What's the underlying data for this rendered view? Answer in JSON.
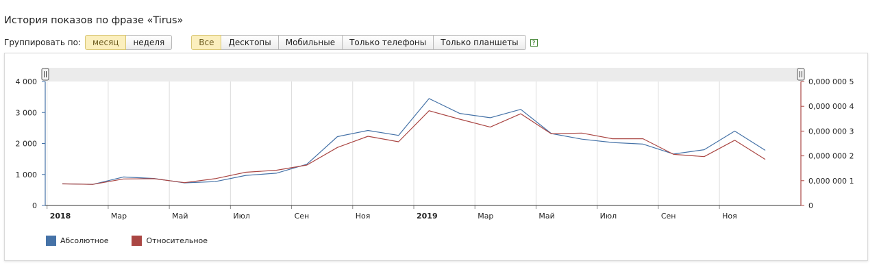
{
  "header": {
    "title": "История показов по фразе «Tirus»"
  },
  "toolbar": {
    "group_label": "Группировать по:",
    "group_buttons": [
      {
        "label": "месяц",
        "active": true
      },
      {
        "label": "неделя",
        "active": false
      }
    ],
    "device_buttons": [
      {
        "label": "Все",
        "active": true
      },
      {
        "label": "Десктопы",
        "active": false
      },
      {
        "label": "Мобильные",
        "active": false
      },
      {
        "label": "Только телефоны",
        "active": false
      },
      {
        "label": "Только планшеты",
        "active": false
      }
    ],
    "help_label": "?"
  },
  "chart_data": {
    "type": "line",
    "x_ticks": [
      "2018",
      "Мар",
      "Май",
      "Июл",
      "Сен",
      "Ноя",
      "2019",
      "Мар",
      "Май",
      "Июл",
      "Сен",
      "Ноя"
    ],
    "x_ticks_bold": [
      "2018",
      "2019"
    ],
    "x": [
      "2018-01",
      "2018-02",
      "2018-03",
      "2018-04",
      "2018-05",
      "2018-06",
      "2018-07",
      "2018-08",
      "2018-09",
      "2018-10",
      "2018-11",
      "2018-12",
      "2019-01",
      "2019-02",
      "2019-03",
      "2019-04",
      "2019-05",
      "2019-06",
      "2019-07",
      "2019-08",
      "2019-09",
      "2019-10",
      "2019-11",
      "2019-12"
    ],
    "y_left": {
      "ticks": [
        "0",
        "1 000",
        "2 000",
        "3 000",
        "4 000"
      ],
      "ylim": [
        0,
        4000
      ]
    },
    "y_right": {
      "ticks": [
        "0",
        "0,000 000 1",
        "0,000 000 2",
        "0,000 000 3",
        "0,000 000 4",
        "0,000 000 5"
      ],
      "ylim": [
        0,
        5e-07
      ]
    },
    "series": [
      {
        "name": "Абсолютное",
        "color": "#4572a7",
        "axis": "left",
        "values": [
          700,
          680,
          920,
          870,
          730,
          770,
          970,
          1040,
          1330,
          2220,
          2420,
          2260,
          3450,
          2970,
          2830,
          3100,
          2320,
          2140,
          2030,
          1980,
          1660,
          1800,
          2400,
          1780
        ]
      },
      {
        "name": "Относительное",
        "color": "#aa4643",
        "axis": "right",
        "values": [
          8.7e-08,
          8.5e-08,
          1.07e-07,
          1.08e-07,
          9.2e-08,
          1.08e-07,
          1.34e-07,
          1.42e-07,
          1.63e-07,
          2.34e-07,
          2.79e-07,
          2.57e-07,
          3.82e-07,
          3.48e-07,
          3.16e-07,
          3.7e-07,
          2.89e-07,
          2.92e-07,
          2.69e-07,
          2.69e-07,
          2.06e-07,
          1.97e-07,
          2.63e-07,
          1.86e-07
        ]
      }
    ],
    "grid": {
      "vertical": true,
      "horizontal": false
    },
    "navigator": true,
    "legend_position": "bottom-left"
  }
}
